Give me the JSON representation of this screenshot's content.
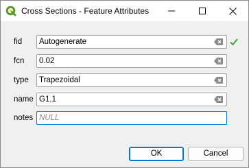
{
  "window": {
    "title": "Cross Sections - Feature Attributes",
    "app_icon": "qgis-icon",
    "controls": [
      "minimize-icon",
      "maximize-icon",
      "close-icon"
    ]
  },
  "fields": [
    {
      "label": "fid",
      "value": "Autogenerate",
      "has_clear": true,
      "valid_check": true
    },
    {
      "label": "fcn",
      "value": "0.02",
      "has_clear": true
    },
    {
      "label": "type",
      "value": "Trapezoidal",
      "has_clear": true
    },
    {
      "label": "name",
      "value": "G1.1",
      "has_clear": true
    },
    {
      "label": "notes",
      "value": "",
      "placeholder": "NULL",
      "focused": true
    }
  ],
  "buttons": {
    "ok": "OK",
    "cancel": "Cancel"
  },
  "colors": {
    "accent": "#0078d4",
    "check": "#3aa935",
    "qgis_green": "#589632"
  }
}
